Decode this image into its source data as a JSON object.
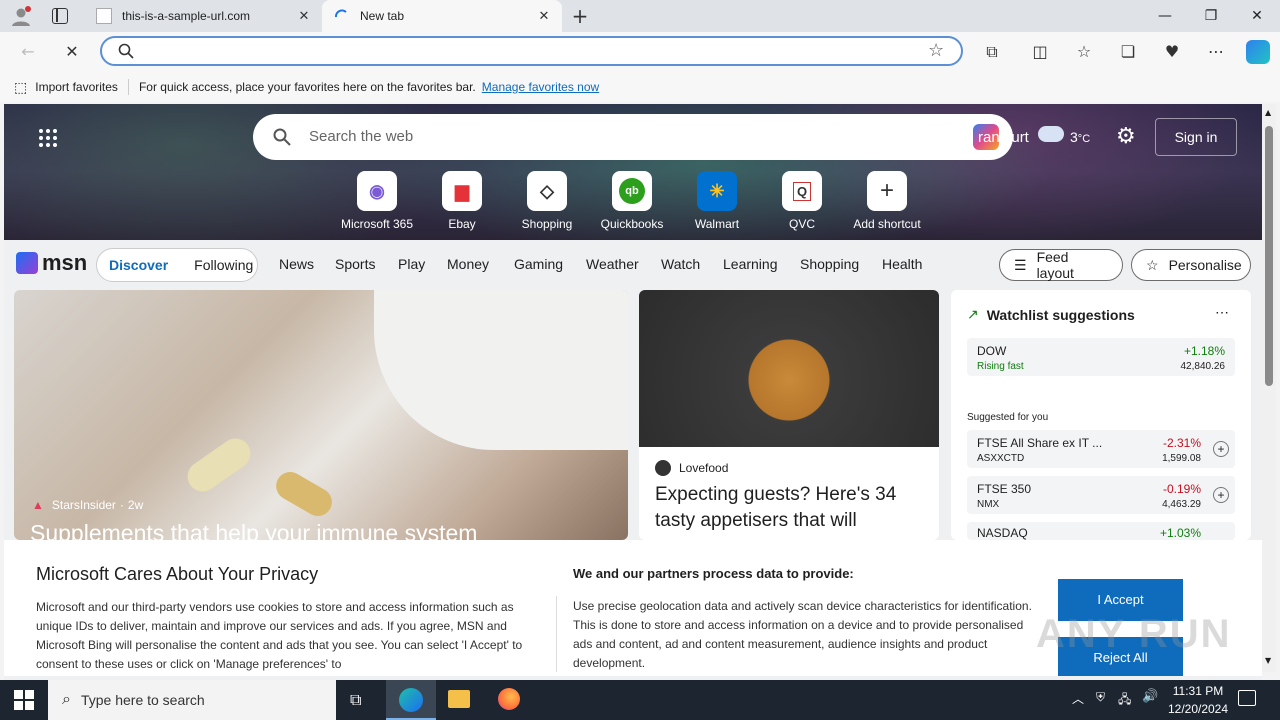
{
  "browser": {
    "tabs": [
      {
        "title": "this-is-a-sample-url.com"
      },
      {
        "title": "New tab"
      }
    ],
    "favorites_bar": {
      "import_label": "Import favorites",
      "hint": "For quick access, place your favorites here on the favorites bar.",
      "manage_link": "Manage favorites now"
    }
  },
  "msn": {
    "search_placeholder": "Search the web",
    "weather_city": "rankfurt",
    "weather_temp": "3",
    "weather_unit": "°C",
    "sign_in": "Sign in",
    "shortcuts": [
      {
        "label": "Microsoft 365"
      },
      {
        "label": "Ebay"
      },
      {
        "label": "Shopping"
      },
      {
        "label": "Quickbooks"
      },
      {
        "label": "Walmart"
      },
      {
        "label": "QVC"
      },
      {
        "label": "Add shortcut"
      }
    ],
    "logo_text": "msn",
    "nav": {
      "discover": "Discover",
      "following": "Following",
      "links": [
        "News",
        "Sports",
        "Play",
        "Money",
        "Gaming",
        "Weather",
        "Watch",
        "Learning",
        "Shopping",
        "Health"
      ],
      "feed_layout": "Feed layout",
      "personalise": "Personalise"
    },
    "main_card": {
      "source": "StarsInsider",
      "age": "2w",
      "headline": "Supplements that help your immune system"
    },
    "food_card": {
      "source": "Lovefood",
      "headline": "Expecting guests? Here's 34 tasty appetisers that will"
    },
    "watchlist": {
      "title": "Watchlist suggestions",
      "top": {
        "name": "DOW",
        "change": "+1.18%",
        "note": "Rising fast",
        "value": "42,840.26"
      },
      "suggested_label": "Suggested for you",
      "items": [
        {
          "name": "FTSE All Share ex IT ...",
          "sub": "ASXXCTD",
          "change": "-2.31%",
          "value": "1,599.08"
        },
        {
          "name": "FTSE 350",
          "sub": "NMX",
          "change": "-0.19%",
          "value": "4,463.29"
        },
        {
          "name": "NASDAQ",
          "sub": "",
          "change": "+1.03%",
          "value": ""
        }
      ]
    },
    "privacy": {
      "title": "Microsoft Cares About Your Privacy",
      "body": "Microsoft and our third-party vendors use cookies to store and access information such as unique IDs to deliver, maintain and improve our services and ads. If you agree, MSN and Microsoft Bing will personalise the content and ads that you see. You can select 'I Accept' to consent to these uses or click on 'Manage preferences' to",
      "partners_title": "We and our partners process data to provide:",
      "partners_body": "Use precise geolocation data and actively scan device characteristics for identification. This is done to store and access information on a device and to provide personalised ads and content, ad and content measurement, audience insights and product development.",
      "accept": "I Accept",
      "reject": "Reject All"
    }
  },
  "taskbar": {
    "search_placeholder": "Type here to search",
    "time": "11:31 PM",
    "date": "12/20/2024"
  },
  "watermark": "ANY RUN",
  "colors": {
    "accent": "#0f6cbd",
    "positive": "#107c10",
    "negative": "#c50f1f"
  }
}
